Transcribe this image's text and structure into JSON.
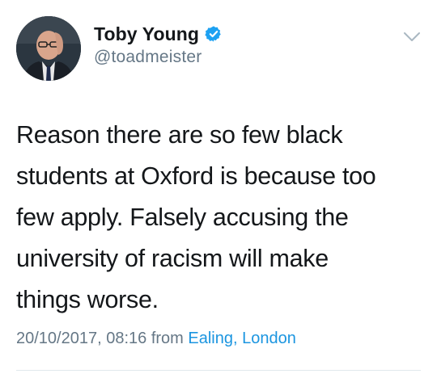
{
  "author": {
    "display_name": "Toby Young",
    "handle": "@toadmeister",
    "verified": true,
    "avatar_icon": "profile-photo"
  },
  "tweet": {
    "lines": [
      "Reason there are so few black",
      "students at Oxford is because too",
      "few apply. Falsely accusing the",
      "university of racism will make",
      "things worse."
    ],
    "timestamp": "20/10/2017, 08:16",
    "from_label": "from",
    "location": "Ealing, London"
  },
  "colors": {
    "text": "#14171a",
    "secondary": "#657786",
    "link": "#1b95e0",
    "verified_badge": "#1da1f2",
    "divider": "#e1e8ed"
  },
  "icons": {
    "verified": "verified-badge-icon",
    "menu": "chevron-down-icon"
  }
}
